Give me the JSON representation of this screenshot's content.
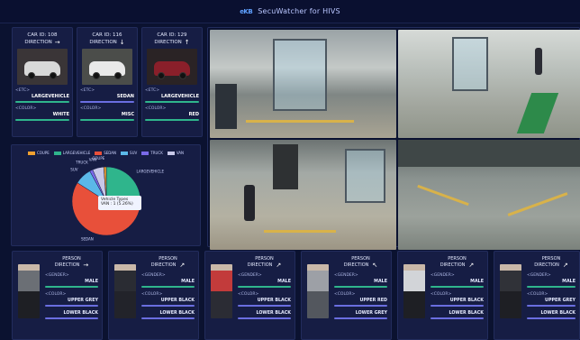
{
  "header": {
    "logo": "eKB",
    "title": "SecuWatcher for HIVS"
  },
  "cars": [
    {
      "id": "CAR ID: 108",
      "direction": "DIRECTION",
      "arrow": "→",
      "etc_label": "<ETC>",
      "etc_value": "LARGEVEHICLE",
      "color_label": "<COLOR>",
      "color_value": "WHITE",
      "etc_bar": "#2fb58c",
      "color_bar": "#2fb58c",
      "thumb_bg": "#3a3537",
      "car_color": "#d8d8d8"
    },
    {
      "id": "CAR ID: 116",
      "direction": "DIRECTION",
      "arrow": "↓",
      "etc_label": "<ETC>",
      "etc_value": "SEDAN",
      "color_label": "<COLOR>",
      "color_value": "MISC",
      "etc_bar": "#6a6ee0",
      "color_bar": "#2fb58c",
      "thumb_bg": "#4b4d4a",
      "car_color": "#e9e9e9"
    },
    {
      "id": "CAR ID: 129",
      "direction": "DIRECTION",
      "arrow": "↑",
      "etc_label": "<ETC>",
      "etc_value": "LARGEVEHICLE",
      "color_label": "<COLOR>",
      "color_value": "RED",
      "etc_bar": "#2fb58c",
      "color_bar": "#2fb58c",
      "thumb_bg": "#2a2325",
      "car_color": "#8a1f2a"
    }
  ],
  "legend": [
    {
      "label": "COUPE",
      "color": "#f0a030"
    },
    {
      "label": "LARGEVEHICLE",
      "color": "#2fb58c"
    },
    {
      "label": "SEDAN",
      "color": "#e8503a"
    },
    {
      "label": "SUV",
      "color": "#5bb8e8"
    },
    {
      "label": "TRUCK",
      "color": "#7a6ae8"
    },
    {
      "label": "VAN",
      "color": "#c8c8e8"
    }
  ],
  "chart_data": {
    "type": "pie",
    "title": "",
    "categories": [
      "LARGEVEHICLE",
      "SEDAN",
      "SUV",
      "TRUCK",
      "VAN",
      "COUPE"
    ],
    "values": [
      26,
      58,
      8,
      1.5,
      5.3,
      1.2
    ],
    "slice_labels": [
      "LARGEVEHICLE",
      "SEDAN",
      "SUV",
      "TRUCK",
      "VAN",
      "COUPE"
    ],
    "tooltip": {
      "title": "Vehicle Types",
      "line": "VAN : 1 (5.26%)"
    }
  },
  "persons": [
    {
      "title": "PERSON",
      "direction": "DIRECTION",
      "arrow": "→",
      "gender_label": "<GENDER>",
      "gender": "MALE",
      "color_label": "<COLOR>",
      "upper": "UPPER GREY",
      "lower": "LOWER BLACK",
      "shirt": "#6b6f75",
      "pants": "#1e1f24"
    },
    {
      "title": "PERSON",
      "direction": "DIRECTION",
      "arrow": "↗",
      "gender_label": "<GENDER>",
      "gender": "MALE",
      "color_label": "<COLOR>",
      "upper": "UPPER BLACK",
      "lower": "LOWER BLACK",
      "shirt": "#2a2c33",
      "pants": "#22232a"
    },
    {
      "title": "PERSON",
      "direction": "DIRECTION",
      "arrow": "↗",
      "gender_label": "<GENDER>",
      "gender": "MALE",
      "color_label": "<COLOR>",
      "upper": "UPPER BLACK",
      "lower": "LOWER BLACK",
      "shirt": "#c23b3b",
      "pants": "#2b2c34"
    },
    {
      "title": "PERSON",
      "direction": "DIRECTION",
      "arrow": "↖",
      "gender_label": "<GENDER>",
      "gender": "MALE",
      "color_label": "<COLOR>",
      "upper": "UPPER RED",
      "lower": "LOWER GREY",
      "shirt": "#9da0a6",
      "pants": "#53575e"
    },
    {
      "title": "PERSON",
      "direction": "DIRECTION",
      "arrow": "↗",
      "gender_label": "<GENDER>",
      "gender": "MALE",
      "color_label": "<COLOR>",
      "upper": "UPPER BLACK",
      "lower": "LOWER BLACK",
      "shirt": "#d2d4d8",
      "pants": "#1e1f24"
    },
    {
      "title": "PERSON",
      "direction": "DIRECTION",
      "arrow": "↗",
      "gender_label": "<GENDER>",
      "gender": "MALE",
      "color_label": "<COLOR>",
      "upper": "UPPER GREY",
      "lower": "LOWER BLACK",
      "shirt": "#303238",
      "pants": "#1e1f24"
    }
  ]
}
